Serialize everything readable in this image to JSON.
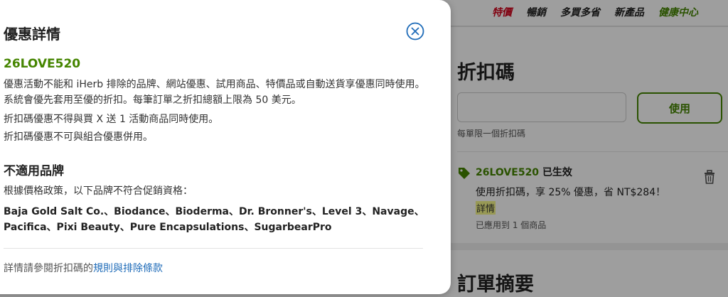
{
  "background": {
    "nav": [
      {
        "label": "特價",
        "color": "#d0021b"
      },
      {
        "label": "暢銷"
      },
      {
        "label": "多買多省"
      },
      {
        "label": "新產品"
      },
      {
        "label": "健康中心",
        "color": "#458500"
      }
    ],
    "coupon_title": "折扣碼",
    "coupon_input_value": "",
    "apply_label": "使用",
    "hint": "每單限一個折扣碼",
    "applied": {
      "code": "26LOVE520",
      "status": "已生效",
      "desc": "使用折扣碼，享 25% 優惠，省 NT$284！",
      "details": "詳情",
      "count": "已應用到 1 個商品"
    },
    "summary_title": "訂單摘要"
  },
  "modal": {
    "title": "優惠詳情",
    "code": "26LOVE520",
    "para1": "優惠活動不能和 iHerb 排除的品牌、網站優惠、試用商品、特價品或自動送貨享優惠同時使用。系統會優先套用至優的折扣。每筆訂單之折扣總額上限為 50 美元。",
    "para2": "折扣碼優惠不得與買 X 送 1 活動商品同時使用。",
    "para3": "折扣碼優惠不可與組合優惠併用。",
    "excluded_title": "不適用品牌",
    "excluded_intro": "根據價格政策，以下品牌不符合促銷資格：",
    "brands": "Baja Gold Salt Co.、Biodance、Bioderma、Dr. Bronner's、Level 3、Navage、Pacifica、Pixi Beauty、Pure Encapsulations、SugarbearPro",
    "footer_text": "詳情請參閱折扣碼的",
    "footer_link": "規則與排除條款"
  },
  "colors": {
    "brand_green": "#458500",
    "sale_red": "#d0021b",
    "link_blue": "#1e6bb8",
    "highlight": "#f5f78a"
  },
  "icons": [
    "close-icon",
    "tag-icon",
    "trash-icon"
  ]
}
